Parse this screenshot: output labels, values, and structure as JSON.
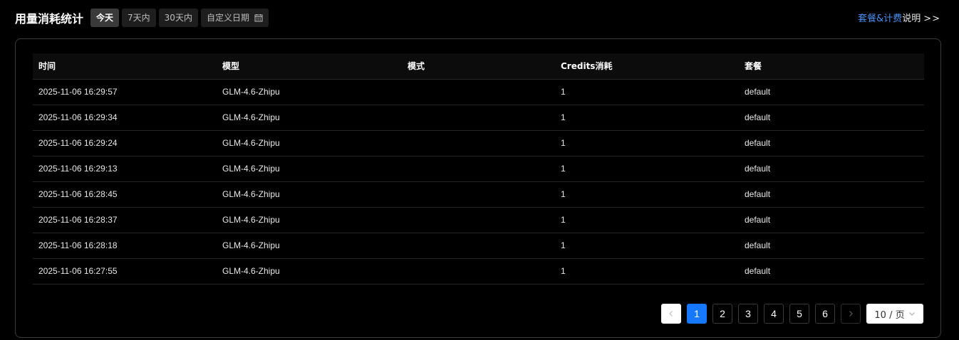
{
  "header": {
    "title": "用量消耗统计",
    "ranges": [
      "今天",
      "7天内",
      "30天内"
    ],
    "custom_date_label": "自定义日期",
    "plan_link_part1": "套餐&计费",
    "plan_link_part2": "说明",
    "plan_link_arrow": ">>"
  },
  "table": {
    "columns": [
      "时间",
      "模型",
      "模式",
      "Credits消耗",
      "套餐"
    ],
    "rows": [
      {
        "time": "2025-11-06 16:29:57",
        "model": "GLM-4.6-Zhipu",
        "mode": "",
        "credits": "1",
        "plan": "default"
      },
      {
        "time": "2025-11-06 16:29:34",
        "model": "GLM-4.6-Zhipu",
        "mode": "",
        "credits": "1",
        "plan": "default"
      },
      {
        "time": "2025-11-06 16:29:24",
        "model": "GLM-4.6-Zhipu",
        "mode": "",
        "credits": "1",
        "plan": "default"
      },
      {
        "time": "2025-11-06 16:29:13",
        "model": "GLM-4.6-Zhipu",
        "mode": "",
        "credits": "1",
        "plan": "default"
      },
      {
        "time": "2025-11-06 16:28:45",
        "model": "GLM-4.6-Zhipu",
        "mode": "",
        "credits": "1",
        "plan": "default"
      },
      {
        "time": "2025-11-06 16:28:37",
        "model": "GLM-4.6-Zhipu",
        "mode": "",
        "credits": "1",
        "plan": "default"
      },
      {
        "time": "2025-11-06 16:28:18",
        "model": "GLM-4.6-Zhipu",
        "mode": "",
        "credits": "1",
        "plan": "default"
      },
      {
        "time": "2025-11-06 16:27:55",
        "model": "GLM-4.6-Zhipu",
        "mode": "",
        "credits": "1",
        "plan": "default"
      }
    ]
  },
  "pagination": {
    "pages": [
      "1",
      "2",
      "3",
      "4",
      "5",
      "6"
    ],
    "current": "1",
    "page_size": "10 / 页"
  },
  "colors": {
    "accent": "#1677ff",
    "link": "#4a8ff0"
  }
}
